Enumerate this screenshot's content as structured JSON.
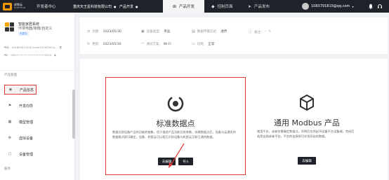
{
  "topbar": {
    "logo_title": "虎智云",
    "logo_sub": "HUZHIYUN",
    "dev_center": "开发者中心",
    "company": "重庆天王星科技有限公司",
    "product_label": "产品开发",
    "nav": [
      {
        "label": "产品开发",
        "icon": "grid-icon",
        "active": true
      },
      {
        "label": "控制页面",
        "icon": "control-icon",
        "active": false
      },
      {
        "label": "产品发布",
        "icon": "send-icon",
        "active": false
      }
    ],
    "user_email": "1083791810@qq.com"
  },
  "sidebar": {
    "product_name": "智能家居系统",
    "product_category": "环境电器/烤箱/自定义",
    "draft_badge": "开发中",
    "pid_label": "PID:",
    "pid_value": "b5c8e06204f41a4bd297835e7a...",
    "pk_label": "PK:",
    "pk_value": "5f5c••••••••••••••••••5234",
    "section_title": "产品管理",
    "items": [
      {
        "label": "产品信息",
        "icon": "info-icon",
        "active": true
      },
      {
        "label": "开发向导",
        "icon": "guide-icon",
        "active": false
      },
      {
        "label": "模型管理",
        "icon": "model-icon",
        "active": false
      },
      {
        "label": "虚拟设备",
        "icon": "virtual-device-icon",
        "active": false
      },
      {
        "label": "设备管理",
        "icon": "device-icon",
        "active": false
      }
    ],
    "section_title_2": "服务"
  },
  "info": {
    "created_label": "创建：",
    "created_value": "2023/05/30",
    "device_type_label": "设备类型：",
    "device_type_value": "单品",
    "data_transfer_label": "数据传输方式：",
    "data_transfer_value": "透传",
    "note_label": "备注：",
    "note_value": "-",
    "updated_label": "更新：",
    "updated_value": "2023/05/30",
    "comm_label": "通讯方案：",
    "comm_value": "Wi-Fi",
    "power_label": "功耗：",
    "power_value": "正常"
  },
  "cards": {
    "standard": {
      "title": "标准数据点",
      "desc": "数据点即设备产品的功能的抽象，用于描述产品功能及其参数，创建数据点后，设备与云通讯的数据格式即可确定，设备、机智云可以相互识别设备与机智云互联互通的数据。",
      "edit_label": "去编辑",
      "import_label": "导入"
    },
    "modbus": {
      "title": "通用 Modbus 产品",
      "desc": "使用平台，或者仅需确定数据点，声明后台到gOS设备平台设备端，完成后若您自助或者平台，平台的连接即可实现导出的数据。",
      "edit_label": "去编辑"
    }
  },
  "colors": {
    "topbar": "#1f2329",
    "highlight": "#e53935",
    "accent_logo": "#f39800"
  }
}
